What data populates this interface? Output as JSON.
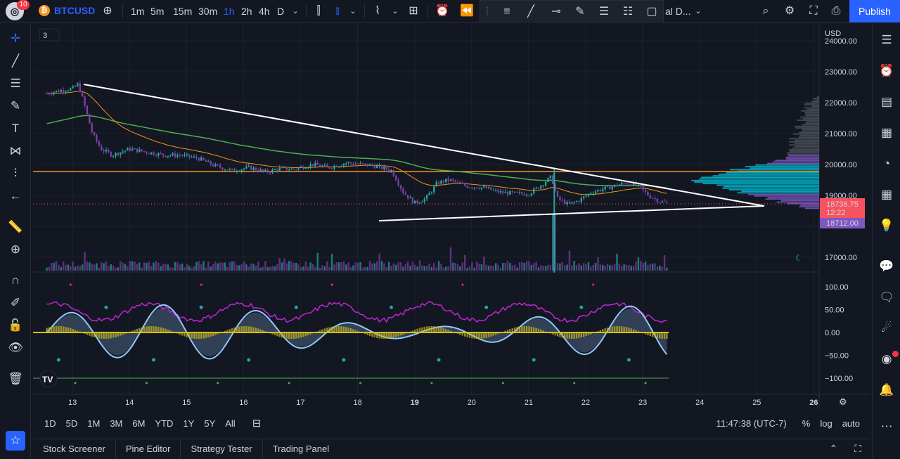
{
  "header": {
    "notification_count": "10",
    "symbol": "BTCUSD",
    "timeframes": [
      "1m",
      "5m",
      "15m",
      "30m",
      "1h",
      "2h",
      "4h",
      "D"
    ],
    "active_timeframe": "1h",
    "layout_name": "al D...",
    "publish_label": "Publish"
  },
  "chart_data": {
    "type": "line",
    "x_labels": [
      "13",
      "14",
      "15",
      "16",
      "17",
      "18",
      "19",
      "20",
      "21",
      "22",
      "23",
      "24",
      "25",
      "26"
    ],
    "price_axis": [
      "24000.00",
      "23000.00",
      "22000.00",
      "21000.00",
      "20000.00",
      "19000.00",
      "17000.00"
    ],
    "currency": "USD",
    "last_price": "18736.75",
    "countdown": "12:22",
    "ma_price": "18712.00",
    "osc_axis": [
      "100.00",
      "50.00",
      "0.00",
      "−50.00",
      "−100.00"
    ],
    "pane_count_label": "3",
    "price_points": [
      [
        12.55,
        22300
      ],
      [
        12.8,
        22400
      ],
      [
        13.0,
        22450
      ],
      [
        13.1,
        22600
      ],
      [
        13.2,
        22000
      ],
      [
        13.35,
        21000
      ],
      [
        13.5,
        20500
      ],
      [
        13.7,
        20300
      ],
      [
        14.0,
        20500
      ],
      [
        14.3,
        20400
      ],
      [
        14.6,
        20300
      ],
      [
        14.9,
        20300
      ],
      [
        15.2,
        20200
      ],
      [
        15.5,
        19950
      ],
      [
        15.8,
        19800
      ],
      [
        16.1,
        19900
      ],
      [
        16.4,
        19750
      ],
      [
        16.6,
        19850
      ],
      [
        16.9,
        19850
      ],
      [
        17.2,
        20000
      ],
      [
        17.5,
        19900
      ],
      [
        17.8,
        20050
      ],
      [
        18.1,
        20000
      ],
      [
        18.3,
        19950
      ],
      [
        18.6,
        19800
      ],
      [
        18.8,
        19100
      ],
      [
        19.0,
        18750
      ],
      [
        19.2,
        18900
      ],
      [
        19.4,
        19400
      ],
      [
        19.6,
        19500
      ],
      [
        19.9,
        19300
      ],
      [
        20.2,
        19250
      ],
      [
        20.5,
        19100
      ],
      [
        20.8,
        19050
      ],
      [
        21.0,
        19050
      ],
      [
        21.2,
        19300
      ],
      [
        21.4,
        19600
      ],
      [
        21.5,
        18900
      ],
      [
        21.7,
        18700
      ],
      [
        21.9,
        18850
      ],
      [
        22.1,
        19100
      ],
      [
        22.3,
        19200
      ],
      [
        22.5,
        19300
      ],
      [
        22.7,
        19400
      ],
      [
        22.9,
        19350
      ],
      [
        23.1,
        19000
      ],
      [
        23.3,
        18800
      ],
      [
        23.45,
        18740
      ]
    ]
  },
  "bottom": {
    "ranges": [
      "1D",
      "5D",
      "1M",
      "3M",
      "6M",
      "YTD",
      "1Y",
      "5Y",
      "All"
    ],
    "clock": "11:47:38 (UTC-7)",
    "percent_label": "%",
    "log_label": "log",
    "auto_label": "auto"
  },
  "panels": [
    "Stock Screener",
    "Pine Editor",
    "Strategy Tester",
    "Trading Panel"
  ],
  "colors": {
    "accent": "#2962ff",
    "up": "#26a69a",
    "down": "#7b3fa8",
    "ema_orange": "#f7931a",
    "sma_green": "#4caf50",
    "last_price_bg": "#f7525f",
    "ma_label_bg": "#7e57c2"
  }
}
